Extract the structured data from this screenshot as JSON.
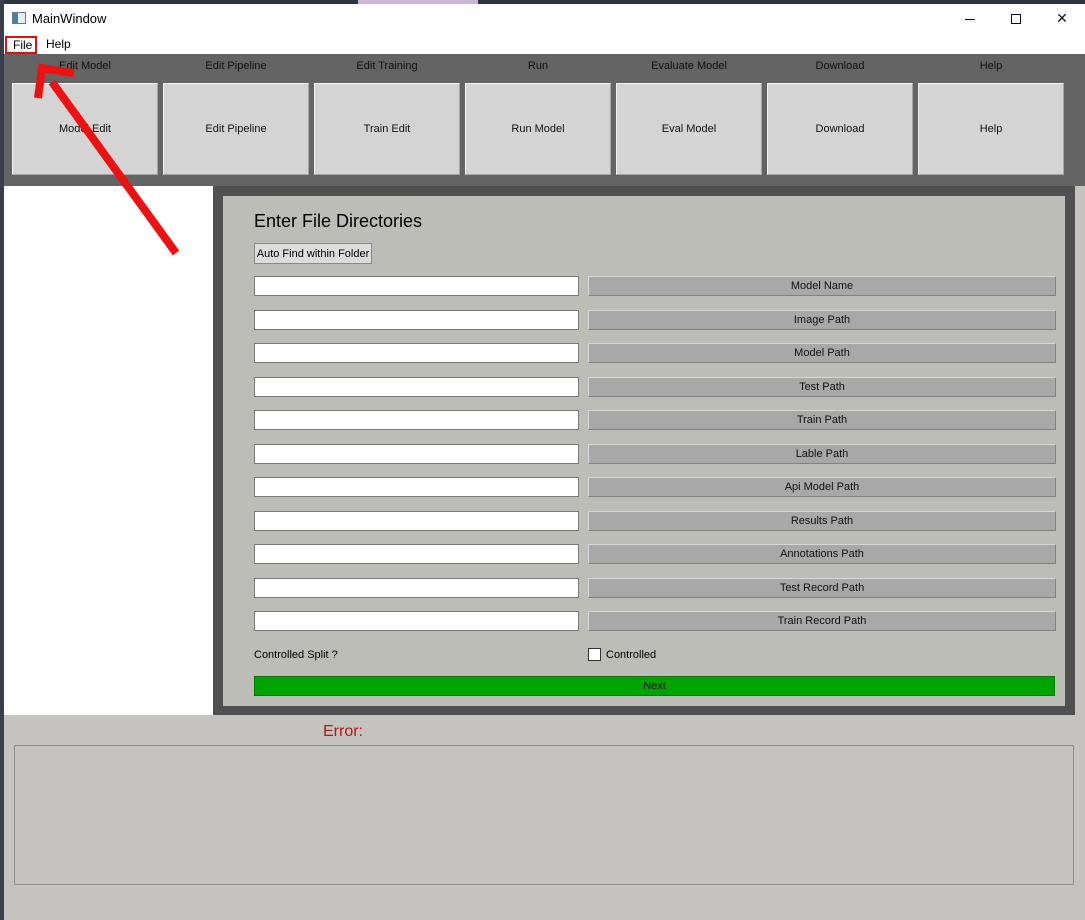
{
  "window": {
    "title": "MainWindow"
  },
  "menu": {
    "file": "File",
    "help": "Help"
  },
  "toolbar": {
    "sections": [
      {
        "caption": "Edit Model",
        "button": "Model Edit"
      },
      {
        "caption": "Edit Pipeline",
        "button": "Edit Pipeline"
      },
      {
        "caption": "Edit Training",
        "button": "Train Edit"
      },
      {
        "caption": "Run",
        "button": "Run Model"
      },
      {
        "caption": "Evaluate Model",
        "button": "Eval Model"
      },
      {
        "caption": "Download",
        "button": "Download"
      },
      {
        "caption": "Help",
        "button": "Help"
      }
    ]
  },
  "panel": {
    "title": "Enter File Directories",
    "auto_find": "Auto Find within Folder",
    "fields": [
      {
        "label": "Model Name",
        "value": ""
      },
      {
        "label": "Image Path",
        "value": ""
      },
      {
        "label": "Model Path",
        "value": ""
      },
      {
        "label": "Test Path",
        "value": ""
      },
      {
        "label": "Train Path",
        "value": ""
      },
      {
        "label": "Lable Path",
        "value": ""
      },
      {
        "label": "Api Model Path",
        "value": ""
      },
      {
        "label": "Results Path",
        "value": ""
      },
      {
        "label": "Annotations Path",
        "value": ""
      },
      {
        "label": "Test Record Path",
        "value": ""
      },
      {
        "label": "Train Record Path",
        "value": ""
      }
    ],
    "split_label": "Controlled Split ?",
    "checkbox_label": "Controlled",
    "checkbox_checked": false,
    "next": "Next"
  },
  "error": {
    "label": "Error:",
    "text": ""
  },
  "colors": {
    "toolbar_bg": "#646464",
    "panel_bg": "#bcbdb6",
    "next_green": "#00a400",
    "error_red": "#b01818",
    "annotation_red": "#ee1111"
  }
}
